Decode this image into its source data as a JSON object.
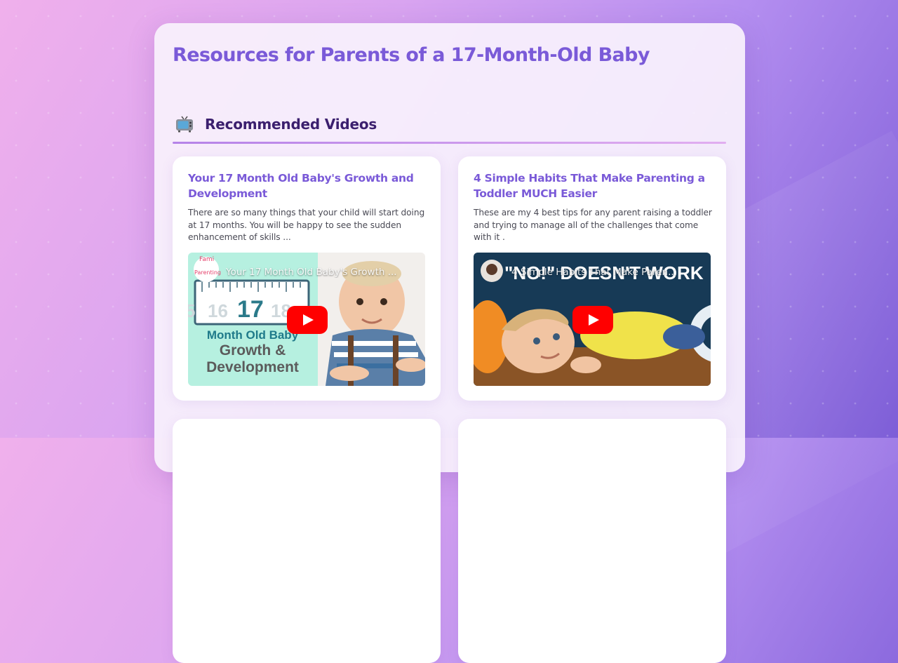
{
  "page": {
    "title": "Resources for Parents of a 17-Month-Old Baby"
  },
  "videos_section": {
    "icon": "tv-icon",
    "title": "Recommended Videos"
  },
  "videos": [
    {
      "title": "Your 17 Month Old Baby's Growth and Development",
      "description": "There are so many things that your child will start doing at 17 months. You will be happy to see the sudden enhancement of skills ...",
      "thumbnail": {
        "caption": "Your 17 Month Old Baby's Growth ...",
        "brand_line1": "Fami",
        "brand_line2": "Parenting",
        "ruler_numbers": [
          "5",
          "16",
          "17",
          "18"
        ],
        "line1": "Month Old Baby",
        "line2": "Growth &",
        "line3": "Development"
      }
    },
    {
      "title": "4 Simple Habits That Make Parenting a Toddler MUCH Easier",
      "description": "These are my 4 best tips for any parent raising a toddler and trying to manage all of the challenges that come with it .",
      "thumbnail": {
        "caption": "4 Simple Habits That Make Paren...",
        "banner": "\"NO!\" DOESN'T WORK"
      }
    }
  ],
  "colors": {
    "accent": "#7a5ad8",
    "section_title": "#3b1f6e",
    "play_button": "#ff0000"
  }
}
